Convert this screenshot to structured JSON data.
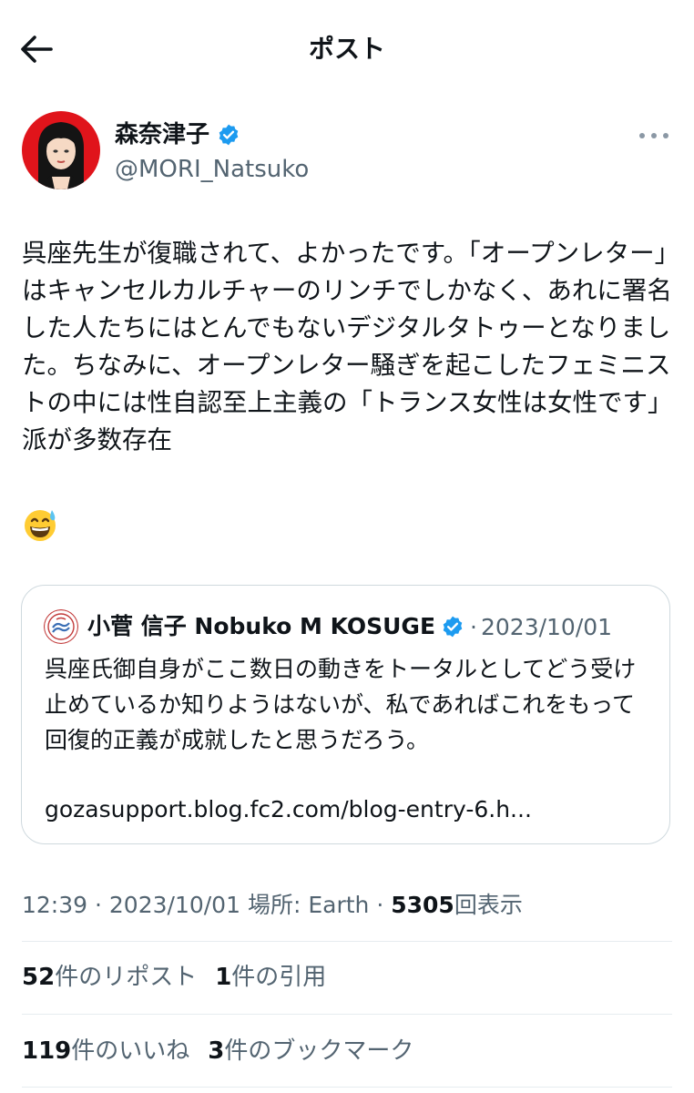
{
  "header": {
    "title": "ポスト",
    "back_icon": "arrow-left-icon"
  },
  "author": {
    "display_name": "森奈津子",
    "handle": "@MORI_Natsuko",
    "verified": true,
    "verified_color": "#1d9bf0",
    "more_icon": "more-horizontal-icon"
  },
  "post": {
    "text": "呉座先生が復職されて、よかったです。「オープンレター」はキャンセルカルチャーのリンチでしかなく、あれに署名した人たちにはとんでもないデジタルタトゥーとなりました。ちなみに、オープンレター騒ぎを起こしたフェミニストの中には性自認至上主義の「トランス女性は女性です」派が多数存在",
    "emoji": "grinning-face-with-sweat-emoji"
  },
  "quote": {
    "display_name": "小菅 信子 Nobuko M KOSUGE",
    "verified": true,
    "separator": "·",
    "date": "2023/10/01",
    "text": "呉座氏御自身がここ数日の動きをトータルとしてどう受け止めているか知りようはないが、私であればこれをもって回復的正義が成就したと思うだろう。",
    "link": "gozasupport.blog.fc2.com/blog-entry-6.h..."
  },
  "meta": {
    "time": "12:39",
    "sep1": "·",
    "date": "2023/10/01",
    "location": "場所: Earth",
    "sep2": "·",
    "views_count": "5305",
    "views_label": "回表示"
  },
  "stats": {
    "reposts_count": "52",
    "reposts_label": "件のリポスト",
    "quotes_count": "1",
    "quotes_label": "件の引用",
    "likes_count": "119",
    "likes_label": "件のいいね",
    "bookmarks_count": "3",
    "bookmarks_label": "件のブックマーク"
  },
  "colors": {
    "text_primary": "#0f1419",
    "text_secondary": "#536471",
    "border": "#cfd9de",
    "accent": "#1d9bf0"
  }
}
